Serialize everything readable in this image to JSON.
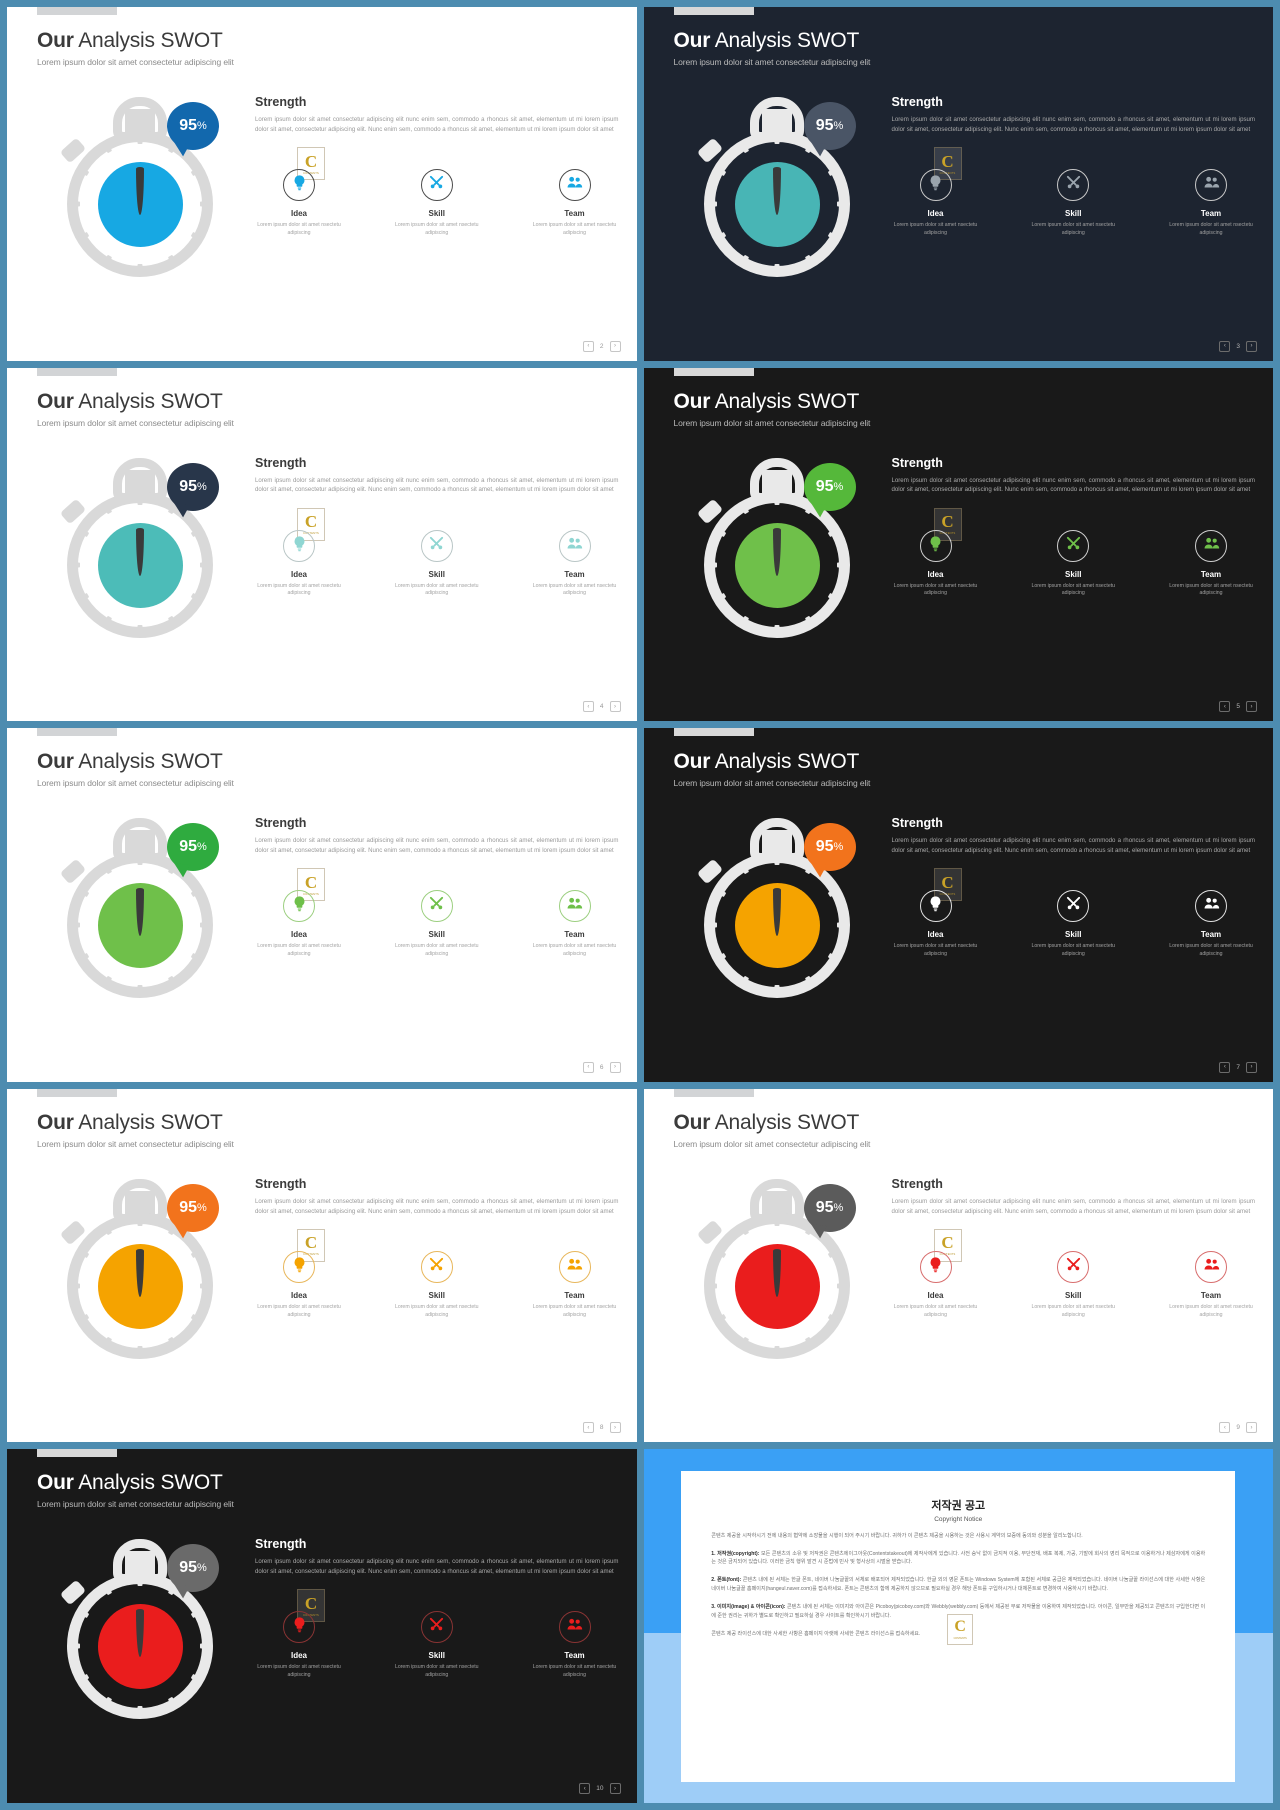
{
  "deck": {
    "title_bold": "Our",
    "title_rest": " Analysis SWOT",
    "subtitle": "Lorem ipsum dolor sit amet consectetur adipiscing elit",
    "percent_value": "95",
    "percent_symbol": "%",
    "strength_heading": "Strength",
    "strength_body": "Lorem ipsum dolor sit amet consectetur adipiscing elit nunc enim sem, commodo a rhoncus sit amet, elementum ut mi lorem ipsum dolor sit amet, consectetur adipiscing elit. Nunc enim sem, commodo a rhoncus sit amet, elementum ut mi lorem ipsum dolor sit amet",
    "features": [
      {
        "icon": "lightbulb-icon",
        "title": "Idea",
        "desc": "Lorem ipsum dolor sit amet nsectetu adipiscing"
      },
      {
        "icon": "tools-icon",
        "title": "Skill",
        "desc": "Lorem ipsum dolor sit amet nsectetu adipiscing"
      },
      {
        "icon": "people-icon",
        "title": "Team",
        "desc": "Lorem ipsum dolor sit amet nsectetu adipiscing"
      }
    ],
    "watermark": {
      "letter": "C",
      "label": "CONTENTS"
    },
    "pager": {
      "prev": "‹",
      "next": "›"
    }
  },
  "slides": [
    {
      "index": 0,
      "theme": "light",
      "accent": "#17a8e3",
      "bubble": "#1268ad",
      "page": "2",
      "icon_color": "#17a8e3",
      "ring_color": "#4b4b4b"
    },
    {
      "index": 1,
      "theme": "dark",
      "accent": "#48b5b5",
      "bubble": "#4a5566",
      "page": "3",
      "icon_color": "#9aa4ad",
      "ring_color": "#c9c9c9"
    },
    {
      "index": 2,
      "theme": "light",
      "accent": "#4cbcb8",
      "bubble": "#28364a",
      "page": "4",
      "icon_color": "#8fd6d2",
      "ring_color": "#b9c6c6"
    },
    {
      "index": 3,
      "theme": "black",
      "accent": "#6fc04a",
      "bubble": "#55b83a",
      "page": "5",
      "icon_color": "#6fc04a",
      "ring_color": "#d0d0d0"
    },
    {
      "index": 4,
      "theme": "light",
      "accent": "#6fc04a",
      "bubble": "#2fab3f",
      "page": "6",
      "icon_color": "#6fc04a",
      "ring_color": "#9ccf80"
    },
    {
      "index": 5,
      "theme": "black",
      "accent": "#f5a300",
      "bubble": "#f2731c",
      "page": "7",
      "icon_color": "#ffffff",
      "ring_color": "#e2e2e2"
    },
    {
      "index": 6,
      "theme": "light",
      "accent": "#f5a300",
      "bubble": "#f2731c",
      "page": "8",
      "icon_color": "#f5a300",
      "ring_color": "#e8b75c"
    },
    {
      "index": 7,
      "theme": "light",
      "accent": "#ea1d1d",
      "bubble": "#5b5b5b",
      "page": "9",
      "icon_color": "#ea1d1d",
      "ring_color": "#d86e6e"
    },
    {
      "index": 8,
      "theme": "black",
      "accent": "#ea1d1d",
      "bubble": "#6a6a6a",
      "page": "10",
      "icon_color": "#ea1d1d",
      "ring_color": "#8a3434"
    }
  ],
  "copyright": {
    "title": "저작권 공고",
    "subtitle": "Copyright Notice",
    "intro": "콘텐츠 제공을 시작하시기 전에 내용의 협약에 소장물을 시행이 되어 주시기 바랍니다. 귀하가 이 콘텐츠 제공을 시용하는 것은 사용시 계약의 보증에 동의와 성분을 알리노합니다.",
    "sections": [
      {
        "label": "1. 저작권(copyright):",
        "text": " 모든 콘텐츠의 소유 및 저작권은 콘텐츠에이그아웃(Contentstakeout)에 제작사에게 있습니다. 사전 승낙 없이 금지적 이용, 무단전재, 배포 복제, 가공, 기발에 회사의 영리 목적으로 이용하거나 제삼자에게 이용하는 것은 금지되어 있습니다. 이러한 금칙 행위 발견 시 준법에 민사 및 형사상의 시벌을 받습니다."
      },
      {
        "label": "2. 폰트(font):",
        "text": " 콘텐츠 내에 된 서체는 한글 폰트, 네이버 나눔글꼴의 서체로 배포되어 제작되었습니다. 한글 외의 영문 폰트는 Windows System에 포함된 서체로 공급은 제작되었습니다. 네이버 나눔글꼴 라이선스에 대한 사세한 사항은 네이버 나눔글꼴 홈페이지(hangeul.naver.com)를 접속하세요. 폰트는 콘텐츠의 함께 제공하지 않으므로 필요하실 경우 해당 폰트를 구입하시거나 대체폰트로 변경하여 사용하시기 바랍니다."
      },
      {
        "label": "3. 이미지(image) & 아이콘(icon):",
        "text": " 콘텐츠 내에 된 서체는 이미지와 아이콘은 Picoboy(picoboy.com)와 Webbly(webbly.com) 등에서 제공된 무료 저작물을 이용하여 제작되었습니다. 아이콘, 일부만을 제공되고 콘텐츠의 구입한다면 이에 준한 권리는 귀하가 별도로 확인하고 필요하실 경우 사이트를 확인하시기 바랍니다."
      }
    ],
    "footer": "콘텐츠 제공 라이선스에 대한 사세한 사항은 홈페이지 아랫에 사세한 콘텐츠 라이선스를 접속하세요.",
    "watermark": {
      "letter": "C",
      "label": "CONTENTS"
    }
  }
}
